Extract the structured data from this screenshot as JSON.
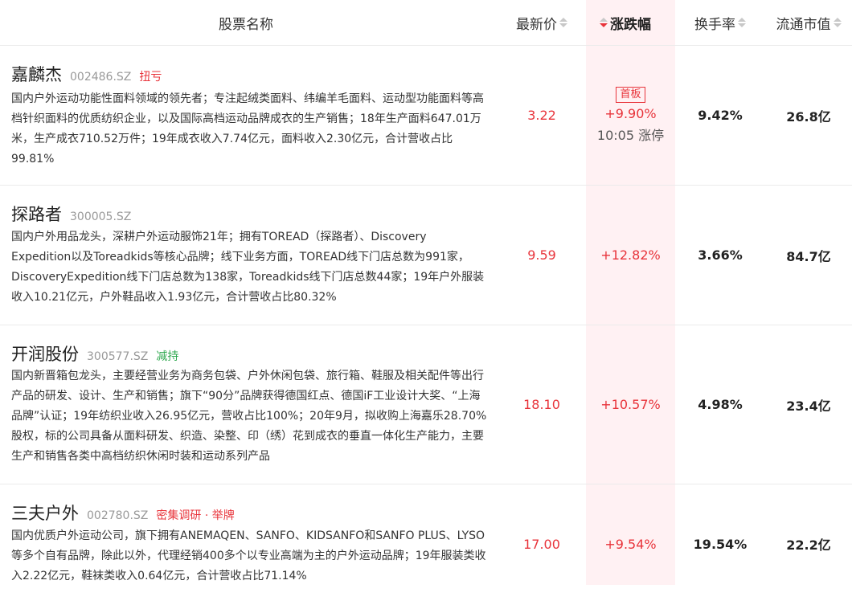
{
  "header": {
    "name": "股票名称",
    "price": "最新价",
    "change": "涨跌幅",
    "turnover": "换手率",
    "mcap": "流通市值"
  },
  "rows": [
    {
      "name": "嘉麟杰",
      "code": "002486.SZ",
      "tags": [
        "扭亏"
      ],
      "desc": "国内户外运动功能性面料领域的领先者；专注起绒类面料、纬编羊毛面料、运动型功能面料等高档针织面料的优质纺织企业，以及国际高档运动品牌成衣的生产销售；18年生产面料647.01万米，生产成衣710.52万件；19年成衣收入7.74亿元，面料收入2.30亿元，合计营收占比99.81%",
      "price": "3.22",
      "badge": "首板",
      "change": "+9.90%",
      "limit_time": "10:05 涨停",
      "turnover": "9.42%",
      "mcap": "26.8亿"
    },
    {
      "name": "探路者",
      "code": "300005.SZ",
      "tags": [],
      "desc": "国内户外用品龙头，深耕户外运动服饰21年；拥有TOREAD（探路者）、Discovery Expedition以及Toreadkids等核心品牌；线下业务方面，TOREAD线下门店总数为991家，DiscoveryExpedition线下门店总数为138家，Toreadkids线下门店总数44家；19年户外服装收入10.21亿元，户外鞋品收入1.93亿元，合计营收占比80.32%",
      "price": "9.59",
      "change": "+12.82%",
      "turnover": "3.66%",
      "mcap": "84.7亿"
    },
    {
      "name": "开润股份",
      "code": "300577.SZ",
      "tags": [
        "减持"
      ],
      "desc": "国内新晋箱包龙头，主要经营业务为商务包袋、户外休闲包袋、旅行箱、鞋服及相关配件等出行产品的研发、设计、生产和销售；旗下“90分”品牌获得德国红点、德国iF工业设计大奖、“上海品牌”认证；19年纺织业收入26.95亿元，营收占比100%；20年9月，拟收购上海嘉乐28.70%股权，标的公司具备从面料研发、织造、染整、印（绣）花到成衣的垂直一体化生产能力，主要生产和销售各类中高档纺织休闲时装和运动系列产品",
      "price": "18.10",
      "change": "+10.57%",
      "turnover": "4.98%",
      "mcap": "23.4亿"
    },
    {
      "name": "三夫户外",
      "code": "002780.SZ",
      "tags": [
        "密集调研 · 举牌"
      ],
      "desc": "国内优质户外运动公司，旗下拥有ANEMAQEN、SANFO、KIDSANFO和SANFO PLUS、LYSO等多个自有品牌，除此以外，代理经销400多个以专业高端为主的户外运动品牌；19年服装类收入2.22亿元，鞋袜类收入0.64亿元，合计营收占比71.14%",
      "price": "17.00",
      "change": "+9.54%",
      "turnover": "19.54%",
      "mcap": "22.2亿"
    }
  ]
}
